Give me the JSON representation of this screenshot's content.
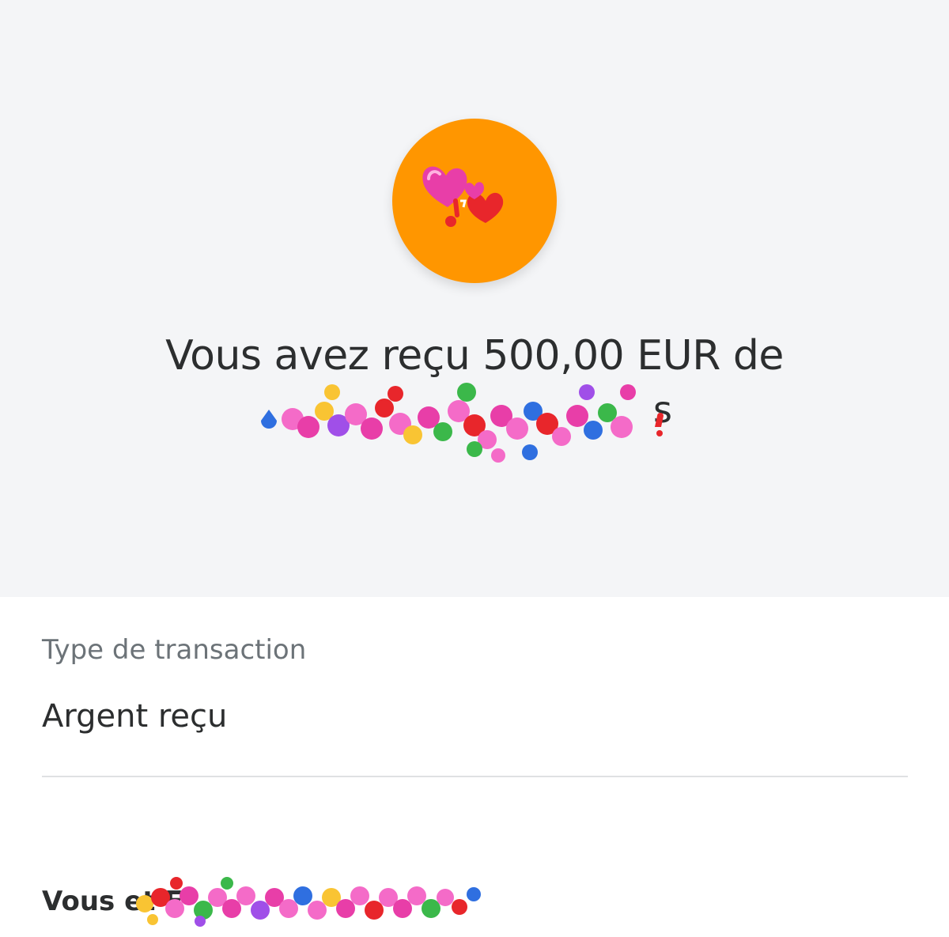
{
  "hero": {
    "avatar_icon": "hearts-emoji-icon",
    "avatar_color": "#ff9600",
    "headline": "Vous avez reçu 500,00 EUR de",
    "sender_visible_fragment": "s",
    "sender_redaction": "heart-emoji-scribble-icon"
  },
  "details": {
    "type_label": "Type de transaction",
    "type_value": "Argent reçu",
    "parties_label": "Vous et F",
    "parties_redaction": "heart-emoji-scribble-icon"
  },
  "colors": {
    "hero_background": "#f4f5f7",
    "avatar": "#ff9600",
    "label_gray": "#6c7378",
    "text_dark": "#2c2e2f",
    "divider": "#dfe1e3"
  }
}
